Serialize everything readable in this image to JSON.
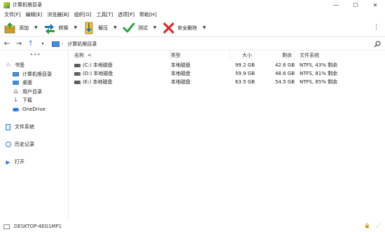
{
  "window": {
    "title": "计算机根目录",
    "minimize": "—",
    "maximize": "☐",
    "close": "✕"
  },
  "menu": [
    "文件[F]",
    "编辑[E]",
    "浏览器[B]",
    "组织[O]",
    "工具[T]",
    "选项[P]",
    "帮助[H]"
  ],
  "toolbar": {
    "add": "添加",
    "convert": "转换",
    "extract": "解压",
    "test": "测试",
    "secure_delete": "安全删除",
    "more": "⋮"
  },
  "address": {
    "path": "计算机根目录"
  },
  "sidebar": {
    "dots": "•••",
    "bookmarks": "书签",
    "items": [
      "计算机根目录",
      "桌面",
      "用户目录",
      "下载",
      "OneDrive"
    ],
    "filesystem": "文件系统",
    "history": "历史记录",
    "open": "打开"
  },
  "table": {
    "headers": [
      "名称",
      "类型",
      "大小",
      "剩余",
      "文件系统"
    ],
    "sort_indicator": "<",
    "rows": [
      {
        "name": "(C:) 本地磁盘",
        "type": "本地磁盘",
        "size": "99.2 GB",
        "free": "42.6 GB",
        "fs": "NTFS, 43% 剩余"
      },
      {
        "name": "(D:) 本地磁盘",
        "type": "本地磁盘",
        "size": "59.9 GB",
        "free": "48.6 GB",
        "fs": "NTFS, 81% 剩余"
      },
      {
        "name": "(E:) 本地磁盘",
        "type": "本地磁盘",
        "size": "63.5 GB",
        "free": "54.5 GB",
        "fs": "NTFS, 85% 剩余"
      }
    ]
  },
  "status": {
    "computer": "DESKTOP-4EG1MP1"
  },
  "colors": {
    "add_box": "#c9a227",
    "convert_blue": "#1e6fc4",
    "convert_green": "#2e9e3a",
    "test_check": "#2ea043",
    "delete_x": "#d42a2a",
    "accent": "#2f7bd6"
  }
}
